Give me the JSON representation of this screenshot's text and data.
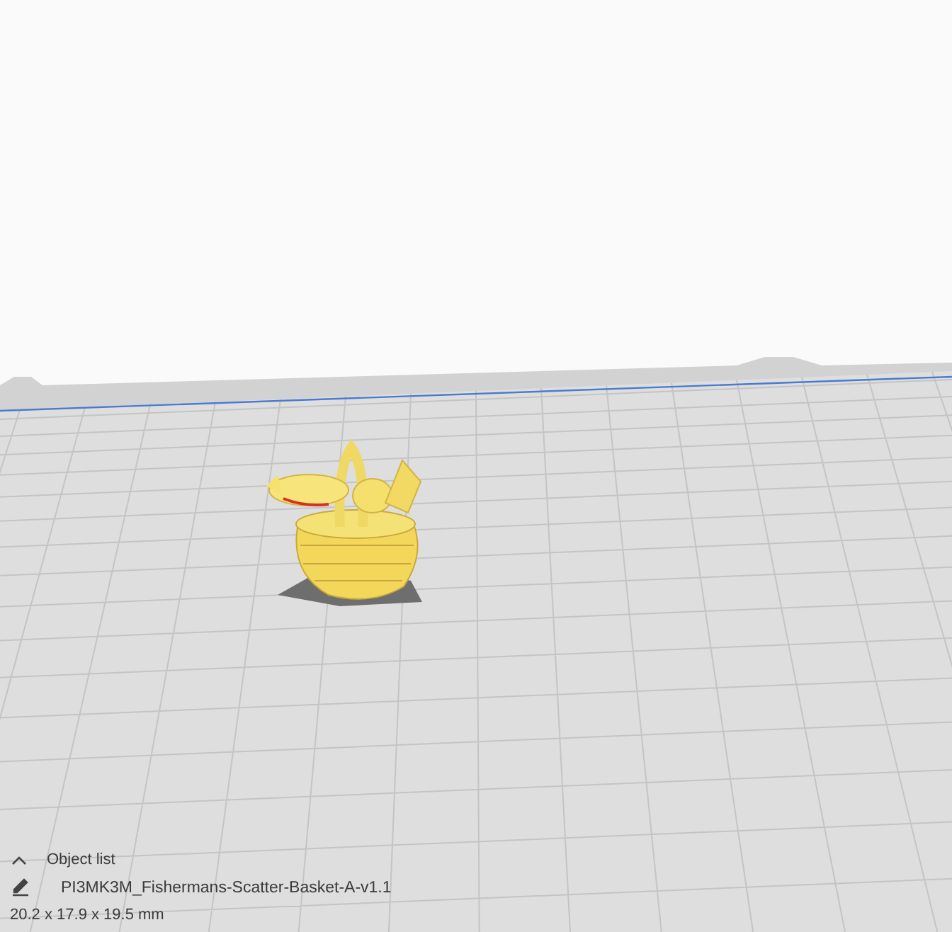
{
  "object_list": {
    "title": "Object list",
    "expanded": true
  },
  "object": {
    "name": "PI3MK3M_Fishermans-Scatter-Basket-A-v1.1",
    "dimensions": "20.2 x 17.9 x 19.5 mm"
  }
}
